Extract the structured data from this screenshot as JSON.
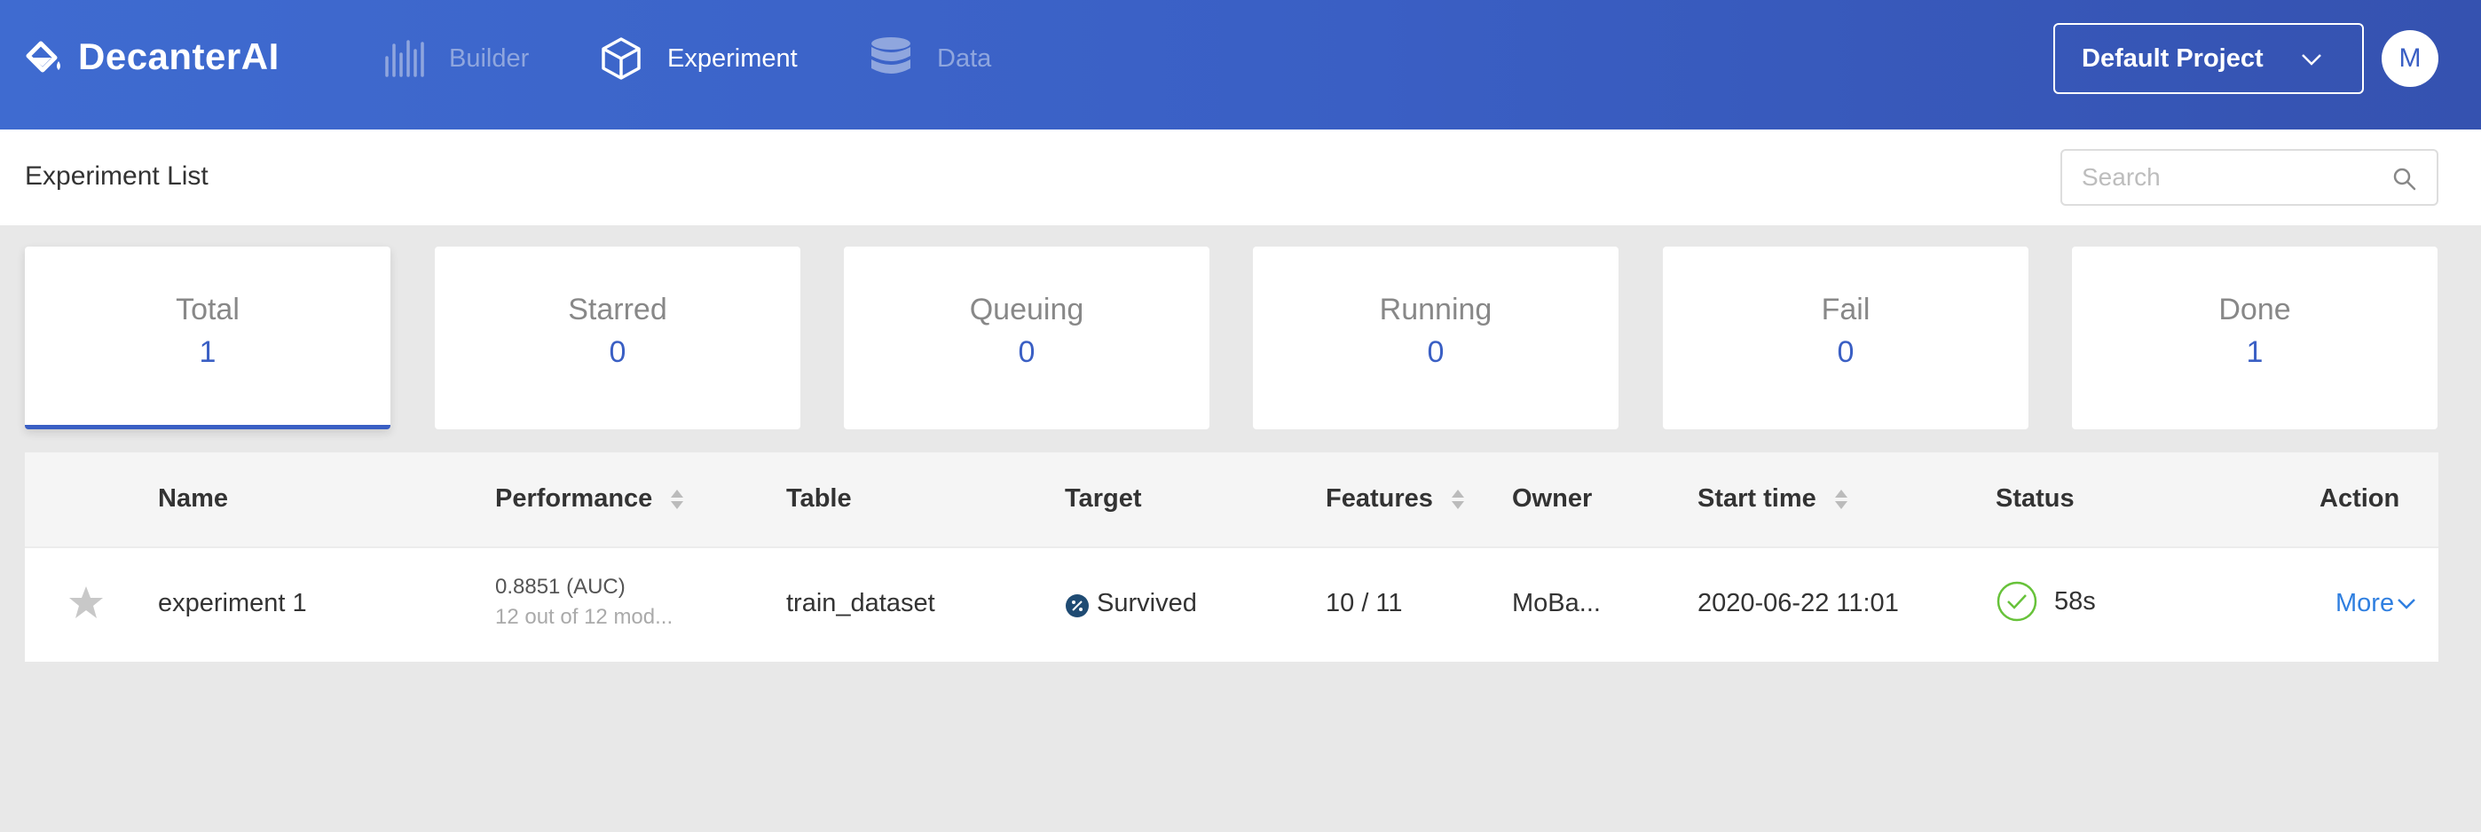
{
  "app": {
    "brand": "DecanterAI"
  },
  "nav": {
    "builder": "Builder",
    "experiment": "Experiment",
    "data": "Data"
  },
  "project": {
    "selected": "Default Project"
  },
  "user": {
    "initial": "M"
  },
  "page": {
    "title": "Experiment List",
    "search_placeholder": "Search"
  },
  "stats": [
    {
      "label": "Total",
      "count": "1"
    },
    {
      "label": "Starred",
      "count": "0"
    },
    {
      "label": "Queuing",
      "count": "0"
    },
    {
      "label": "Running",
      "count": "0"
    },
    {
      "label": "Fail",
      "count": "0"
    },
    {
      "label": "Done",
      "count": "1"
    }
  ],
  "table": {
    "columns": {
      "name": "Name",
      "performance": "Performance",
      "table": "Table",
      "target": "Target",
      "features": "Features",
      "owner": "Owner",
      "start_time": "Start time",
      "status": "Status",
      "action": "Action"
    },
    "rows": [
      {
        "name": "experiment 1",
        "performance": "0.8851 (AUC)",
        "models": "12 out of 12 mod...",
        "table": "train_dataset",
        "target": "Survived",
        "features": "10 / 11",
        "owner": "MoBa...",
        "start_time": "2020-06-22 11:01",
        "duration": "58s",
        "action": "More"
      }
    ]
  },
  "colors": {
    "header": "#3a5fc4",
    "accent": "#3a5fc4",
    "link": "#2f7fe0",
    "success": "#67c23a"
  }
}
